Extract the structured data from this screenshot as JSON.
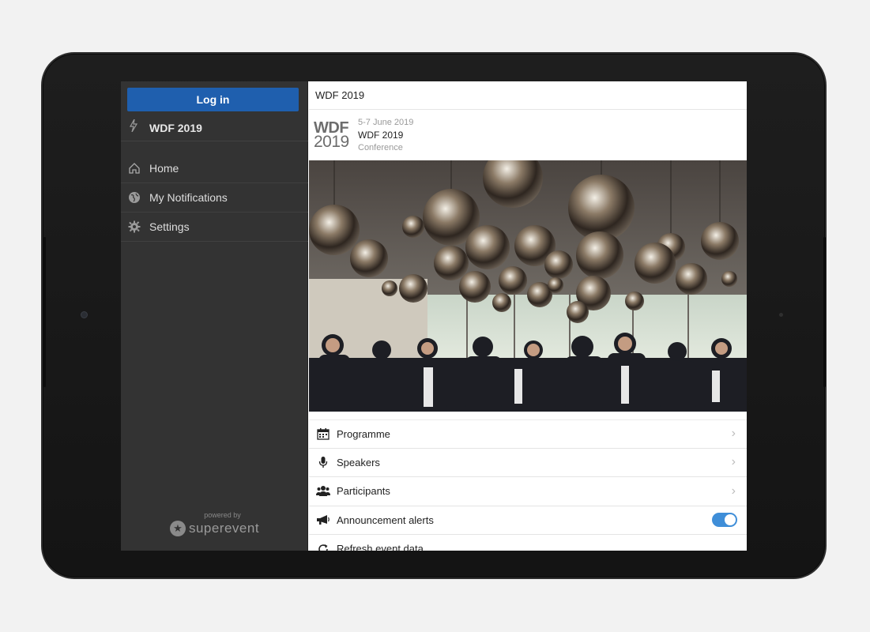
{
  "sidebar": {
    "login_label": "Log in",
    "event_name": "WDF 2019",
    "items": [
      {
        "label": "Home",
        "icon": "home-icon"
      },
      {
        "label": "My Notifications",
        "icon": "globe-icon"
      },
      {
        "label": "Settings",
        "icon": "gear-icon"
      }
    ],
    "powered_by": "powered by",
    "brand": "superevent"
  },
  "main": {
    "title": "WDF 2019",
    "logo_top": "WDF",
    "logo_bottom": "2019",
    "date": "5-7 June 2019",
    "event_name": "WDF 2019",
    "event_type": "Conference",
    "menu": [
      {
        "label": "Programme",
        "icon": "calendar-icon"
      },
      {
        "label": "Speakers",
        "icon": "microphone-icon"
      },
      {
        "label": "Participants",
        "icon": "people-icon"
      },
      {
        "label": "Announcement alerts",
        "icon": "megaphone-icon",
        "toggle_on": true
      },
      {
        "label": "Refresh event data",
        "icon": "refresh-icon"
      }
    ]
  },
  "colors": {
    "login_button": "#1f5fae",
    "sidebar_bg": "#333333",
    "toggle_on": "#3f8ed8"
  }
}
